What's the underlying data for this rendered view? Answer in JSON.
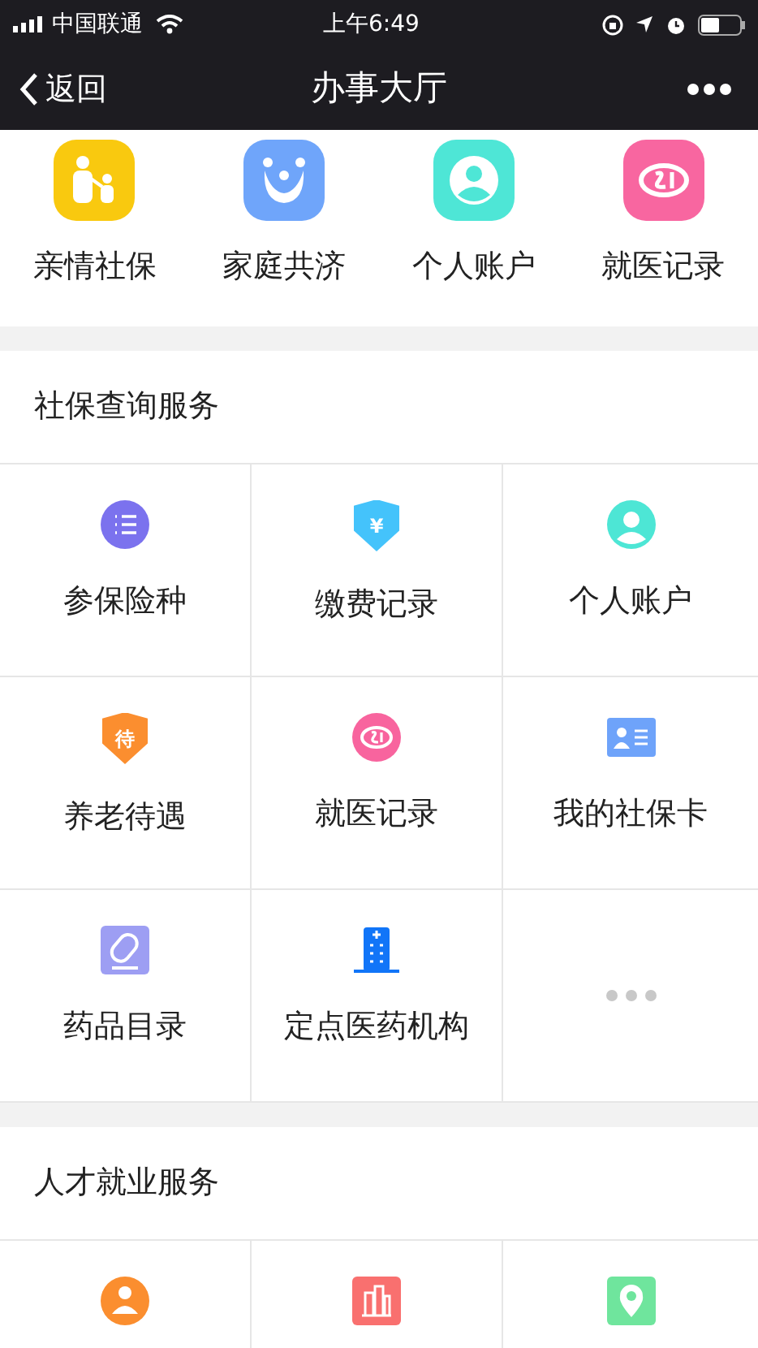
{
  "status_bar": {
    "carrier": "中国联通",
    "time": "上午6:49"
  },
  "nav": {
    "back": "返回",
    "title": "办事大厅"
  },
  "shortcuts": [
    {
      "label": "亲情社保"
    },
    {
      "label": "家庭共济"
    },
    {
      "label": "个人账户"
    },
    {
      "label": "就医记录"
    }
  ],
  "sections": [
    {
      "title": "社保查询服务",
      "items": [
        {
          "kind": "service",
          "label": "参保险种"
        },
        {
          "kind": "shield",
          "glyph": "¥",
          "label": "缴费记录"
        },
        {
          "kind": "service",
          "label": "个人账户"
        },
        {
          "kind": "shield",
          "glyph": "待",
          "label": "养老待遇"
        },
        {
          "kind": "service",
          "label": "就医记录"
        },
        {
          "kind": "service",
          "label": "我的社保卡"
        },
        {
          "kind": "service",
          "label": "药品目录"
        },
        {
          "kind": "service",
          "label": "定点医药机构"
        },
        {
          "kind": "more"
        }
      ]
    },
    {
      "title": "人才就业服务",
      "items": [
        {
          "kind": "service"
        },
        {
          "kind": "service"
        },
        {
          "kind": "service"
        }
      ]
    }
  ]
}
